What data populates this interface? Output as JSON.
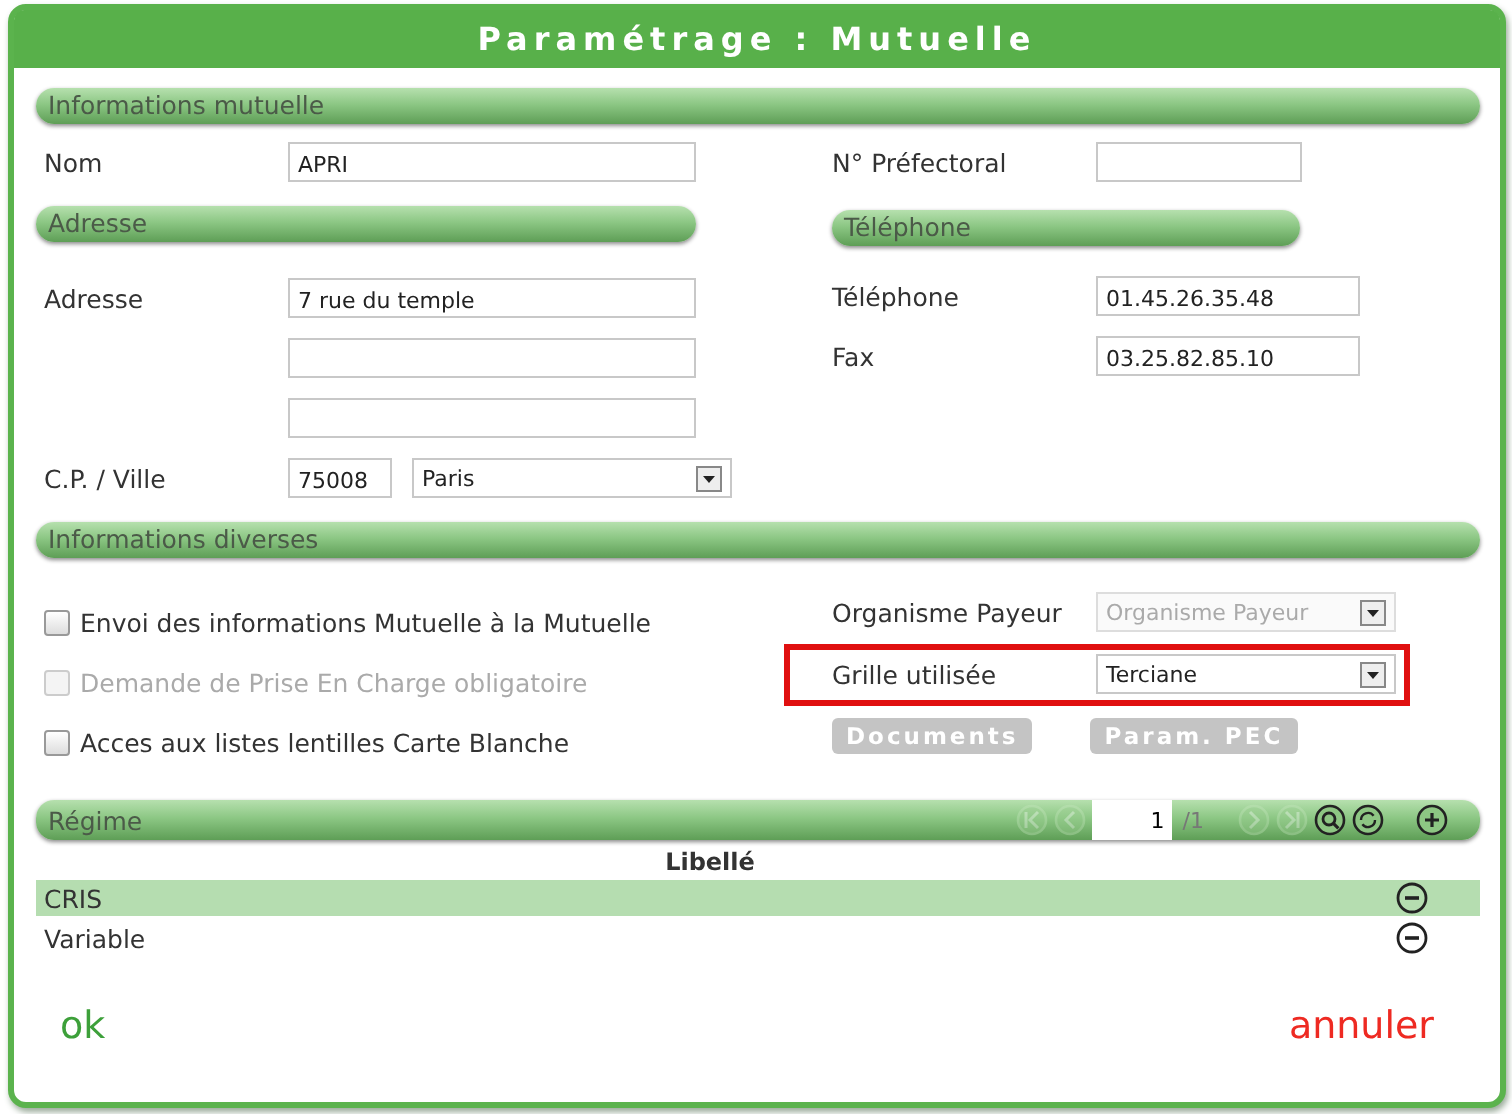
{
  "window": {
    "title": "Paramétrage : Mutuelle"
  },
  "informations_mutuelle": {
    "title": "Informations mutuelle",
    "nom": {
      "label": "Nom",
      "value": "APRI"
    },
    "prefectoral": {
      "label": "N° Préfectoral"
    }
  },
  "adresse": {
    "title": "Adresse",
    "label": "Adresse",
    "lines": [
      {
        "kind": "text",
        "value": "7 rue du temple"
      },
      {
        "kind": "empty"
      },
      {
        "kind": "empty"
      }
    ],
    "cp_label": "C.P. / Ville",
    "cp": "75008",
    "ville": "Paris"
  },
  "telephone": {
    "title": "Téléphone",
    "fields": [
      {
        "label": "Téléphone",
        "value": "01.45.26.35.48"
      },
      {
        "label": "Fax",
        "value": "03.25.82.85.10"
      }
    ]
  },
  "informations_diverses": {
    "title": "Informations diverses",
    "checkboxes": [
      {
        "label": "Envoi des informations Mutuelle à la Mutuelle",
        "checked": false,
        "disabled": false
      },
      {
        "label": "Demande de Prise En Charge obligatoire",
        "checked": false,
        "disabled": true
      },
      {
        "label": "Acces aux listes lentilles Carte Blanche",
        "checked": false,
        "disabled": false
      }
    ],
    "organisme_payeur": {
      "label": "Organisme Payeur",
      "placeholder": "Organisme Payeur",
      "disabled": true
    },
    "grille": {
      "label": "Grille utilisée",
      "value": "Terciane",
      "highlighted": true
    },
    "buttons": [
      {
        "label": "Documents",
        "disabled": true
      },
      {
        "label": "Param. PEC",
        "disabled": true
      }
    ]
  },
  "regime": {
    "title": "Régime",
    "pager": {
      "page": "1",
      "total": "/1"
    },
    "columns": [
      "Libellé"
    ],
    "rows": [
      {
        "label": "CRIS",
        "selected": true
      },
      {
        "label": "Variable",
        "selected": false
      }
    ]
  },
  "footer": {
    "ok": "ok",
    "cancel": "annuler"
  }
}
